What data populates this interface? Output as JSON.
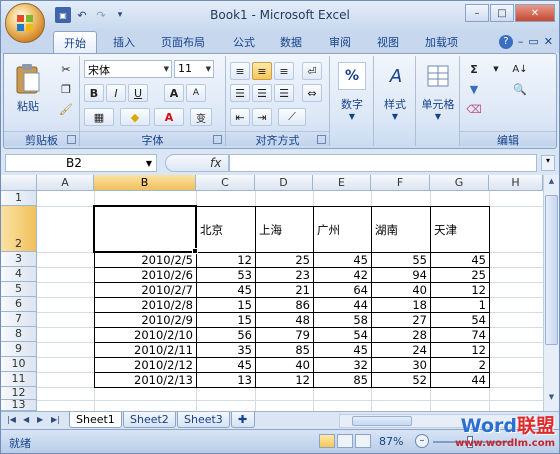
{
  "window": {
    "title": "Book1 - Microsoft Excel",
    "controls": [
      "–",
      "□",
      "✕"
    ]
  },
  "qat": {
    "undo": "↶",
    "redo": "↷",
    "save": "💾",
    "more": "▾"
  },
  "tabs": [
    "开始",
    "插入",
    "页面布局",
    "公式",
    "数据",
    "审阅",
    "视图",
    "加载项"
  ],
  "tab_icons": [
    "?",
    "–",
    "▭",
    "✕"
  ],
  "ribbon": {
    "clipboard": {
      "paste": "粘贴",
      "label": "剪贴板"
    },
    "font": {
      "name": "宋体",
      "size": "11",
      "label": "字体",
      "bold": "B",
      "italic": "I",
      "underline": "U",
      "grow": "A",
      "shrink": "A",
      "fontcolor": "A",
      "wen": "变"
    },
    "alignment": {
      "label": "对齐方式"
    },
    "number": {
      "label": "数字",
      "pct": "%"
    },
    "styles": {
      "label": "样式"
    },
    "cells": {
      "label": "单元格"
    },
    "editing": {
      "label": "编辑",
      "sigma": "Σ",
      "sort": "A↓"
    }
  },
  "formula_bar": {
    "name_box": "B2",
    "fx": "fx",
    "formula": ""
  },
  "columns": [
    "A",
    "B",
    "C",
    "D",
    "E",
    "F",
    "G",
    "H"
  ],
  "rows": [
    "1",
    "2",
    "3",
    "4",
    "5",
    "6",
    "7",
    "8",
    "9",
    "10",
    "11",
    "12",
    "13"
  ],
  "table": {
    "headers": [
      "",
      "北京",
      "上海",
      "广州",
      "湖南",
      "天津"
    ],
    "data": [
      [
        "2010/2/5",
        "12",
        "25",
        "45",
        "55",
        "45"
      ],
      [
        "2010/2/6",
        "53",
        "23",
        "42",
        "94",
        "25"
      ],
      [
        "2010/2/7",
        "45",
        "21",
        "64",
        "40",
        "12"
      ],
      [
        "2010/2/8",
        "15",
        "86",
        "44",
        "18",
        "1"
      ],
      [
        "2010/2/9",
        "15",
        "48",
        "58",
        "27",
        "54"
      ],
      [
        "2010/2/10",
        "56",
        "79",
        "54",
        "28",
        "74"
      ],
      [
        "2010/2/11",
        "35",
        "85",
        "45",
        "24",
        "12"
      ],
      [
        "2010/2/12",
        "45",
        "40",
        "32",
        "30",
        "2"
      ],
      [
        "2010/2/13",
        "13",
        "12",
        "85",
        "52",
        "44"
      ]
    ]
  },
  "sheets": [
    "Sheet1",
    "Sheet2",
    "Sheet3"
  ],
  "status": {
    "ready": "就绪",
    "zoom": "87%"
  },
  "watermark": {
    "logo_a": "Word",
    "logo_b": "联盟",
    "url": "www.wordlm.com"
  }
}
